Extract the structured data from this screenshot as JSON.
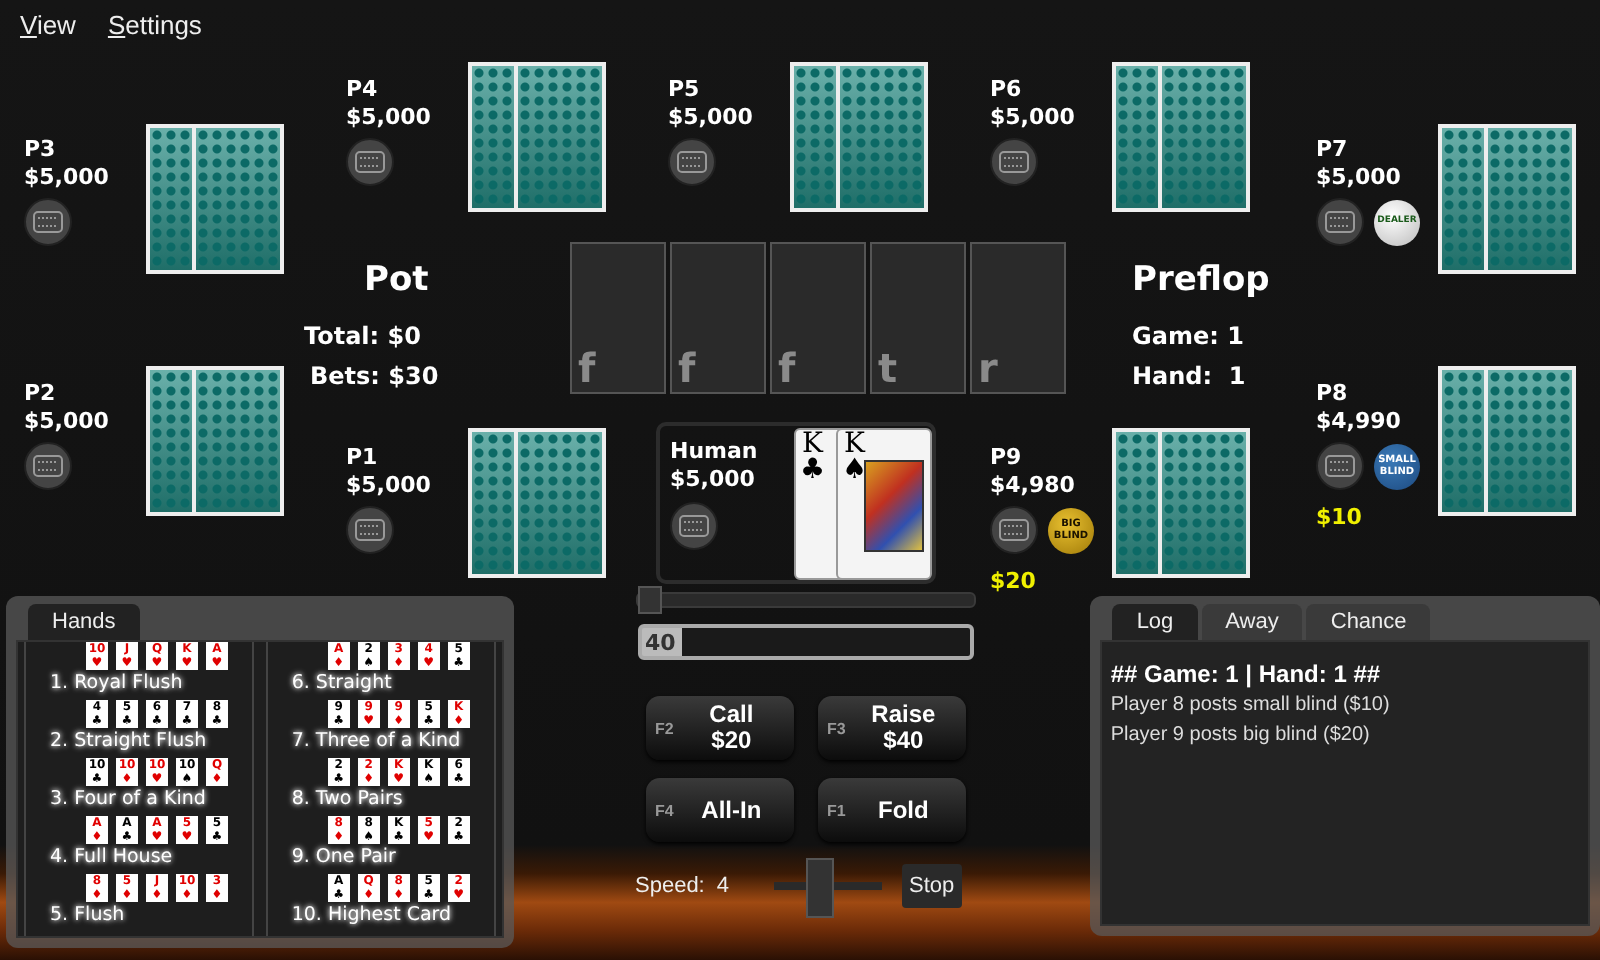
{
  "menu": [
    {
      "label": "View"
    },
    {
      "label": "Settings"
    }
  ],
  "seats": [
    {
      "name": "P4",
      "stack": "$5,000"
    },
    {
      "name": "P5",
      "stack": "$5,000"
    },
    {
      "name": "P6",
      "stack": "$5,000"
    },
    {
      "name": "P3",
      "stack": "$5,000"
    },
    {
      "name": "P7",
      "stack": "$5,000",
      "marker": {
        "kind": "dealer",
        "label": "DEALER"
      }
    },
    {
      "name": "P2",
      "stack": "$5,000"
    },
    {
      "name": "P8",
      "stack": "$4,990",
      "marker": {
        "kind": "small_blind",
        "label": "SMALL BLIND"
      },
      "bet": "$10"
    },
    {
      "name": "P1",
      "stack": "$5,000"
    },
    {
      "name": "P9",
      "stack": "$4,980",
      "marker": {
        "kind": "big_blind",
        "label": "BIG BLIND"
      },
      "bet": "$20"
    }
  ],
  "pot": {
    "title": "Pot",
    "total": "Total: $0",
    "bets": "Bets: $30"
  },
  "board": [
    "f",
    "f",
    "f",
    "t",
    "r"
  ],
  "round": {
    "title": "Preflop",
    "game": "Game: 1",
    "hand": "Hand:  1"
  },
  "human": {
    "name": "Human",
    "stack": "$5,000",
    "cards": [
      {
        "rank": "K",
        "suit": "♣",
        "color": "#000000"
      },
      {
        "rank": "K",
        "suit": "♠",
        "color": "#000000"
      }
    ]
  },
  "bet_slider": {
    "level": 0
  },
  "bet_input": {
    "value": "40"
  },
  "actions": [
    {
      "key": "F2",
      "label": "Call",
      "amount": "$20"
    },
    {
      "key": "F3",
      "label": "Raise",
      "amount": "$40"
    },
    {
      "key": "F4",
      "label": "All-In"
    },
    {
      "key": "F1",
      "label": "Fold"
    }
  ],
  "speed": {
    "label": "Speed:",
    "value": "4",
    "level": 0.4,
    "stop": "Stop"
  },
  "hands_panel": {
    "tab": "Hands",
    "hands": [
      {
        "label": "1. Royal Flush",
        "cards": [
          {
            "rank": "10",
            "suit": "♥",
            "color": "#e00000"
          },
          {
            "rank": "J",
            "suit": "♥",
            "color": "#e00000"
          },
          {
            "rank": "Q",
            "suit": "♥",
            "color": "#e00000"
          },
          {
            "rank": "K",
            "suit": "♥",
            "color": "#e00000"
          },
          {
            "rank": "A",
            "suit": "♥",
            "color": "#e00000"
          }
        ]
      },
      {
        "label": "2. Straight Flush",
        "cards": [
          {
            "rank": "4",
            "suit": "♣",
            "color": "#000000"
          },
          {
            "rank": "5",
            "suit": "♣",
            "color": "#000000"
          },
          {
            "rank": "6",
            "suit": "♣",
            "color": "#000000"
          },
          {
            "rank": "7",
            "suit": "♣",
            "color": "#000000"
          },
          {
            "rank": "8",
            "suit": "♣",
            "color": "#000000"
          }
        ]
      },
      {
        "label": "3. Four of a Kind",
        "cards": [
          {
            "rank": "10",
            "suit": "♣",
            "color": "#000000"
          },
          {
            "rank": "10",
            "suit": "♦",
            "color": "#e00000"
          },
          {
            "rank": "10",
            "suit": "♥",
            "color": "#e00000"
          },
          {
            "rank": "10",
            "suit": "♠",
            "color": "#000000"
          },
          {
            "rank": "Q",
            "suit": "♦",
            "color": "#e00000"
          }
        ]
      },
      {
        "label": "4. Full House",
        "cards": [
          {
            "rank": "A",
            "suit": "♦",
            "color": "#e00000"
          },
          {
            "rank": "A",
            "suit": "♣",
            "color": "#000000"
          },
          {
            "rank": "A",
            "suit": "♥",
            "color": "#e00000"
          },
          {
            "rank": "5",
            "suit": "♥",
            "color": "#e00000"
          },
          {
            "rank": "5",
            "suit": "♣",
            "color": "#000000"
          }
        ]
      },
      {
        "label": "5. Flush",
        "cards": [
          {
            "rank": "8",
            "suit": "♦",
            "color": "#e00000"
          },
          {
            "rank": "5",
            "suit": "♦",
            "color": "#e00000"
          },
          {
            "rank": "J",
            "suit": "♦",
            "color": "#e00000"
          },
          {
            "rank": "10",
            "suit": "♦",
            "color": "#e00000"
          },
          {
            "rank": "3",
            "suit": "♦",
            "color": "#e00000"
          }
        ]
      },
      {
        "label": "6. Straight",
        "cards": [
          {
            "rank": "A",
            "suit": "♦",
            "color": "#e00000"
          },
          {
            "rank": "2",
            "suit": "♠",
            "color": "#000000"
          },
          {
            "rank": "3",
            "suit": "♦",
            "color": "#e00000"
          },
          {
            "rank": "4",
            "suit": "♥",
            "color": "#e00000"
          },
          {
            "rank": "5",
            "suit": "♣",
            "color": "#000000"
          }
        ]
      },
      {
        "label": "7. Three of a Kind",
        "cards": [
          {
            "rank": "9",
            "suit": "♣",
            "color": "#000000"
          },
          {
            "rank": "9",
            "suit": "♥",
            "color": "#e00000"
          },
          {
            "rank": "9",
            "suit": "♦",
            "color": "#e00000"
          },
          {
            "rank": "5",
            "suit": "♣",
            "color": "#000000"
          },
          {
            "rank": "K",
            "suit": "♦",
            "color": "#e00000"
          }
        ]
      },
      {
        "label": "8. Two Pairs",
        "cards": [
          {
            "rank": "2",
            "suit": "♣",
            "color": "#000000"
          },
          {
            "rank": "2",
            "suit": "♦",
            "color": "#e00000"
          },
          {
            "rank": "K",
            "suit": "♥",
            "color": "#e00000"
          },
          {
            "rank": "K",
            "suit": "♠",
            "color": "#000000"
          },
          {
            "rank": "6",
            "suit": "♣",
            "color": "#000000"
          }
        ]
      },
      {
        "label": "9. One Pair",
        "cards": [
          {
            "rank": "8",
            "suit": "♦",
            "color": "#e00000"
          },
          {
            "rank": "8",
            "suit": "♠",
            "color": "#000000"
          },
          {
            "rank": "K",
            "suit": "♣",
            "color": "#000000"
          },
          {
            "rank": "5",
            "suit": "♥",
            "color": "#e00000"
          },
          {
            "rank": "2",
            "suit": "♣",
            "color": "#000000"
          }
        ]
      },
      {
        "label": "10. Highest Card",
        "cards": [
          {
            "rank": "A",
            "suit": "♣",
            "color": "#000000"
          },
          {
            "rank": "Q",
            "suit": "♦",
            "color": "#e00000"
          },
          {
            "rank": "8",
            "suit": "♦",
            "color": "#e00000"
          },
          {
            "rank": "5",
            "suit": "♣",
            "color": "#000000"
          },
          {
            "rank": "2",
            "suit": "♥",
            "color": "#e00000"
          }
        ]
      }
    ]
  },
  "log_panel": {
    "tabs": [
      {
        "label": "Log",
        "selected": true
      },
      {
        "label": "Away",
        "selected": false
      },
      {
        "label": "Chance",
        "selected": false
      }
    ],
    "lines": [
      {
        "text": "## Game: 1 | Hand: 1 ##",
        "kind": "heading"
      },
      {
        "text": "Player 8 posts small blind ($10)",
        "kind": "entry"
      },
      {
        "text": "Player 9 posts big blind ($20)",
        "kind": "entry"
      }
    ]
  }
}
